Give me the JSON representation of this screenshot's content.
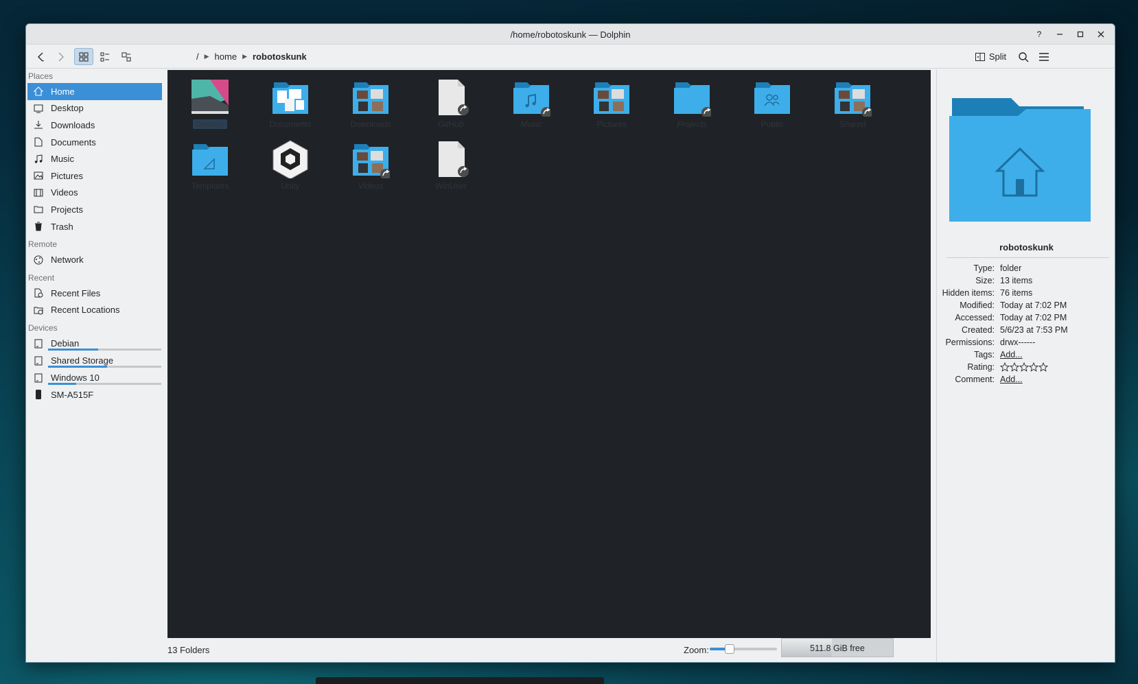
{
  "window": {
    "title": "/home/robotoskunk — Dolphin",
    "help": "?",
    "minimize": "–",
    "maximize": "□",
    "close": "×"
  },
  "toolbar": {
    "breadcrumb": [
      "/",
      "home",
      "robotoskunk"
    ],
    "split_label": "Split"
  },
  "sidebar": {
    "sections": [
      {
        "title": "Places",
        "items": [
          {
            "label": "Home",
            "icon": "home-icon",
            "selected": true
          },
          {
            "label": "Desktop",
            "icon": "desktop-icon"
          },
          {
            "label": "Downloads",
            "icon": "download-icon"
          },
          {
            "label": "Documents",
            "icon": "documents-icon"
          },
          {
            "label": "Music",
            "icon": "music-icon"
          },
          {
            "label": "Pictures",
            "icon": "pictures-icon"
          },
          {
            "label": "Videos",
            "icon": "videos-icon"
          },
          {
            "label": "Projects",
            "icon": "folder-icon"
          },
          {
            "label": "Trash",
            "icon": "trash-icon"
          }
        ]
      },
      {
        "title": "Remote",
        "items": [
          {
            "label": "Network",
            "icon": "network-icon"
          }
        ]
      },
      {
        "title": "Recent",
        "items": [
          {
            "label": "Recent Files",
            "icon": "recent-files-icon"
          },
          {
            "label": "Recent Locations",
            "icon": "recent-locations-icon"
          }
        ]
      },
      {
        "title": "Devices",
        "items": [
          {
            "label": "Debian",
            "icon": "drive-icon",
            "usage": 0.44
          },
          {
            "label": "Shared Storage",
            "icon": "drive-icon",
            "usage": 0.52
          },
          {
            "label": "Windows 10",
            "icon": "drive-icon",
            "usage": 0.25
          },
          {
            "label": "SM-A515F",
            "icon": "phone-icon"
          }
        ]
      }
    ]
  },
  "files": [
    {
      "name": "Desktop",
      "kind": "desktop",
      "italic": false,
      "selected": true
    },
    {
      "name": "Documents",
      "kind": "documents",
      "italic": false
    },
    {
      "name": "Downloads",
      "kind": "downloads",
      "italic": false
    },
    {
      "name": "GitHub",
      "kind": "link-file",
      "italic": true
    },
    {
      "name": "Music",
      "kind": "music",
      "italic": true
    },
    {
      "name": "Pictures",
      "kind": "pictures",
      "italic": false
    },
    {
      "name": "Projects",
      "kind": "folder-link",
      "italic": true
    },
    {
      "name": "Public",
      "kind": "public",
      "italic": false
    },
    {
      "name": "Shared",
      "kind": "shared",
      "italic": true
    },
    {
      "name": "Templates",
      "kind": "templates",
      "italic": false
    },
    {
      "name": "Unity",
      "kind": "unity",
      "italic": false
    },
    {
      "name": "Videos",
      "kind": "videos",
      "italic": true
    },
    {
      "name": "WinUser",
      "kind": "link-file",
      "italic": true
    }
  ],
  "status": {
    "count": "13 Folders",
    "zoom_label": "Zoom:",
    "zoom_level": 0.3,
    "free_space": "511.8 GiB free",
    "used_fraction": 0.45
  },
  "info": {
    "name": "robotoskunk",
    "rows": [
      {
        "key": "Type:",
        "value": "folder"
      },
      {
        "key": "Size:",
        "value": "13 items"
      },
      {
        "key": "Hidden items:",
        "value": "76 items"
      },
      {
        "key": "Modified:",
        "value": "Today at 7:02 PM"
      },
      {
        "key": "Accessed:",
        "value": "Today at 7:02 PM"
      },
      {
        "key": "Created:",
        "value": "5/6/23 at 7:53 PM"
      },
      {
        "key": "Permissions:",
        "value": "drwx------"
      }
    ],
    "tags_key": "Tags:",
    "tags_link": "Add...",
    "rating_key": "Rating:",
    "rating_value": 0,
    "rating_max": 5,
    "comment_key": "Comment:",
    "comment_link": "Add..."
  },
  "colors": {
    "accent": "#3b8fd6",
    "folder": "#3daee9",
    "folder_dark": "#1d7fb8",
    "view_bg": "#1f2226"
  }
}
